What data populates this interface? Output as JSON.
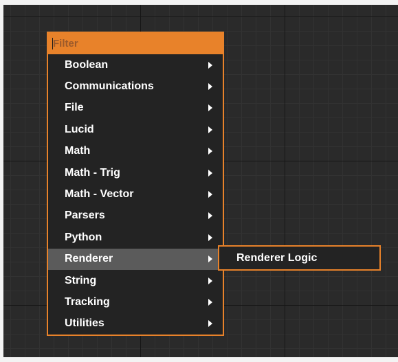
{
  "filter": {
    "placeholder": "Filter"
  },
  "menu": {
    "items": [
      {
        "label": "Boolean"
      },
      {
        "label": "Communications"
      },
      {
        "label": "File"
      },
      {
        "label": "Lucid"
      },
      {
        "label": "Math"
      },
      {
        "label": "Math - Trig"
      },
      {
        "label": "Math - Vector"
      },
      {
        "label": "Parsers"
      },
      {
        "label": "Python"
      },
      {
        "label": "Renderer"
      },
      {
        "label": "String"
      },
      {
        "label": "Tracking"
      },
      {
        "label": "Utilities"
      }
    ],
    "highlighted_item": "Renderer"
  },
  "submenu": {
    "items": [
      {
        "label": "Renderer Logic"
      }
    ]
  },
  "colors": {
    "accent": "#e8822a",
    "menu_background": "#232323",
    "highlight": "#5b5b5b",
    "canvas": "#2a2a2a"
  },
  "icons": {
    "submenu_arrow": "chevron-right-icon"
  }
}
